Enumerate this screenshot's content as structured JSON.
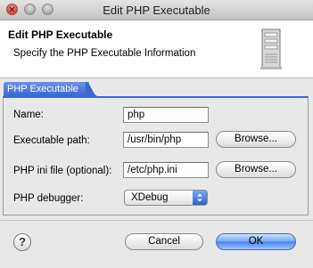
{
  "window": {
    "title": "Edit PHP Executable"
  },
  "banner": {
    "title": "Edit PHP Executable",
    "description": "Specify the PHP Executable Information",
    "icon": "server-icon"
  },
  "tab": {
    "label": "PHP Executable"
  },
  "form": {
    "name_label": "Name:",
    "name_value": "php",
    "path_label": "Executable path:",
    "path_value": "/usr/bin/php",
    "ini_label": "PHP ini file (optional):",
    "ini_value": "/etc/php.ini",
    "debugger_label": "PHP debugger:",
    "debugger_value": "XDebug",
    "browse_label": "Browse..."
  },
  "footer": {
    "help_label": "?",
    "cancel_label": "Cancel",
    "ok_label": "OK"
  },
  "colors": {
    "accent": "#3a68d0",
    "close": "#d8453c"
  }
}
